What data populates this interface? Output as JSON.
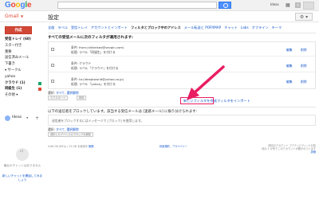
{
  "header": {
    "logo": [
      "G",
      "o",
      "o",
      "g",
      "l",
      "e"
    ],
    "logo_colors": [
      "#4285f4",
      "#ea4335",
      "#fbbc05",
      "#4285f4",
      "#34a853",
      "#ea4335"
    ],
    "user_name": "Ideas"
  },
  "subbar": {
    "app_label": "Gmail",
    "page_title": "設定"
  },
  "sidebar": {
    "compose_label": "作成",
    "items": [
      {
        "label": "受信トレイ (60)",
        "bold": true
      },
      {
        "label": "スター付き",
        "bold": false
      },
      {
        "label": "重要",
        "bold": false
      },
      {
        "label": "送信済みメール",
        "bold": false
      },
      {
        "label": "下書き",
        "bold": false
      },
      {
        "label": "▾ サークル",
        "bold": false
      },
      {
        "label": "yahoo",
        "bold": false
      },
      {
        "label": "クラウド (1)",
        "bold": true,
        "badge": "#16a765"
      },
      {
        "label": "同級生 (1)",
        "bold": true,
        "badge": "#dd4b39"
      },
      {
        "label": "その他 ▾",
        "bold": false
      }
    ],
    "hangouts_name": "Ideas",
    "chat_empty": "最近のチャットはありません",
    "chat_link": "新しいチャットを開始してみましょう"
  },
  "tabs": [
    {
      "label": "全般",
      "active": false
    },
    {
      "label": "ラベル",
      "active": false
    },
    {
      "label": "受信トレイ",
      "active": false
    },
    {
      "label": "アカウントとインポート",
      "active": false
    },
    {
      "label": "フィルタとブロック中のアドレス",
      "active": true
    },
    {
      "label": "メール転送と POP/IMAP",
      "active": false
    },
    {
      "label": "チャット",
      "active": false
    },
    {
      "label": "Labs",
      "active": false
    },
    {
      "label": "オフライン",
      "active": false
    },
    {
      "label": "テーマ",
      "active": false
    }
  ],
  "filters": {
    "heading": "すべての受信メールに次のフィルタが適用されます:",
    "rows": [
      {
        "line1": "条件: from:(nikkeiseo@sevgin.com)",
        "line2": "処理: ラベル「同級生」を付ける"
      },
      {
        "line1": "条件: クラウド",
        "line2": "処理: ラベル「クラウド」を付ける"
      },
      {
        "line1": "条件: to:(ideaptworld@yahoo.co.jp)",
        "line2": "処理: ラベル「yahoo」を付ける"
      }
    ],
    "edit_label": "編集",
    "delete_label": "削除",
    "select_prefix": "選択:",
    "select_all": "すべて",
    "select_none": "選択解除",
    "export_label": "エクスポート",
    "delete_btn_label": "削除",
    "create_filter": "新しいフィルタを作成",
    "import_filter": "フィルタをインポート"
  },
  "blocked": {
    "description": "以下の送信者をブロックしています。該当する受信メールは [迷惑メール] に振り分けられます:",
    "empty": "送信者をブロックするにはメッセージで [ブロック] を使用します。",
    "select_prefix": "選択:",
    "select_all": "すべて",
    "select_none": "選択解除",
    "unblock_label": "選択したアドレスのブロックを解除"
  },
  "footer": {
    "usage": "9.88 GB (65%) / 15 GB を使用中",
    "manage": "管理",
    "terms": "利用規約",
    "privacy": "プライバシー",
    "activity_line1": "前回のアカウント アクティビティ: 0 分前",
    "activity_line2": "他の 1 か所でこのアカウントが開かれています",
    "details": "詳細"
  }
}
